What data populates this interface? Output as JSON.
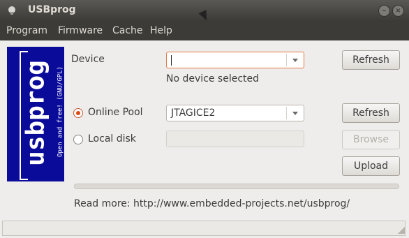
{
  "window": {
    "title": "USBprog"
  },
  "menu": {
    "items": [
      "Program",
      "Firmware",
      "Cache",
      "Help"
    ]
  },
  "logo": {
    "main_text": "usbprog",
    "sub_text": "Open and free! (GNU/GPL)"
  },
  "device": {
    "label": "Device",
    "value": "",
    "status": "No device selected",
    "refresh_label": "Refresh"
  },
  "online_pool": {
    "label": "Online Pool",
    "selected": true,
    "value": "JTAGICE2",
    "refresh_label": "Refresh"
  },
  "local_disk": {
    "label": "Local disk",
    "selected": false,
    "value": "",
    "browse_label": "Browse"
  },
  "upload": {
    "label": "Upload"
  },
  "progress": {
    "value": 0
  },
  "read_more": {
    "text": "Read more: http://www.embedded-projects.net/usbprog/"
  },
  "colors": {
    "logo_bg": "#0b0b9a",
    "accent": "#dd4814"
  }
}
